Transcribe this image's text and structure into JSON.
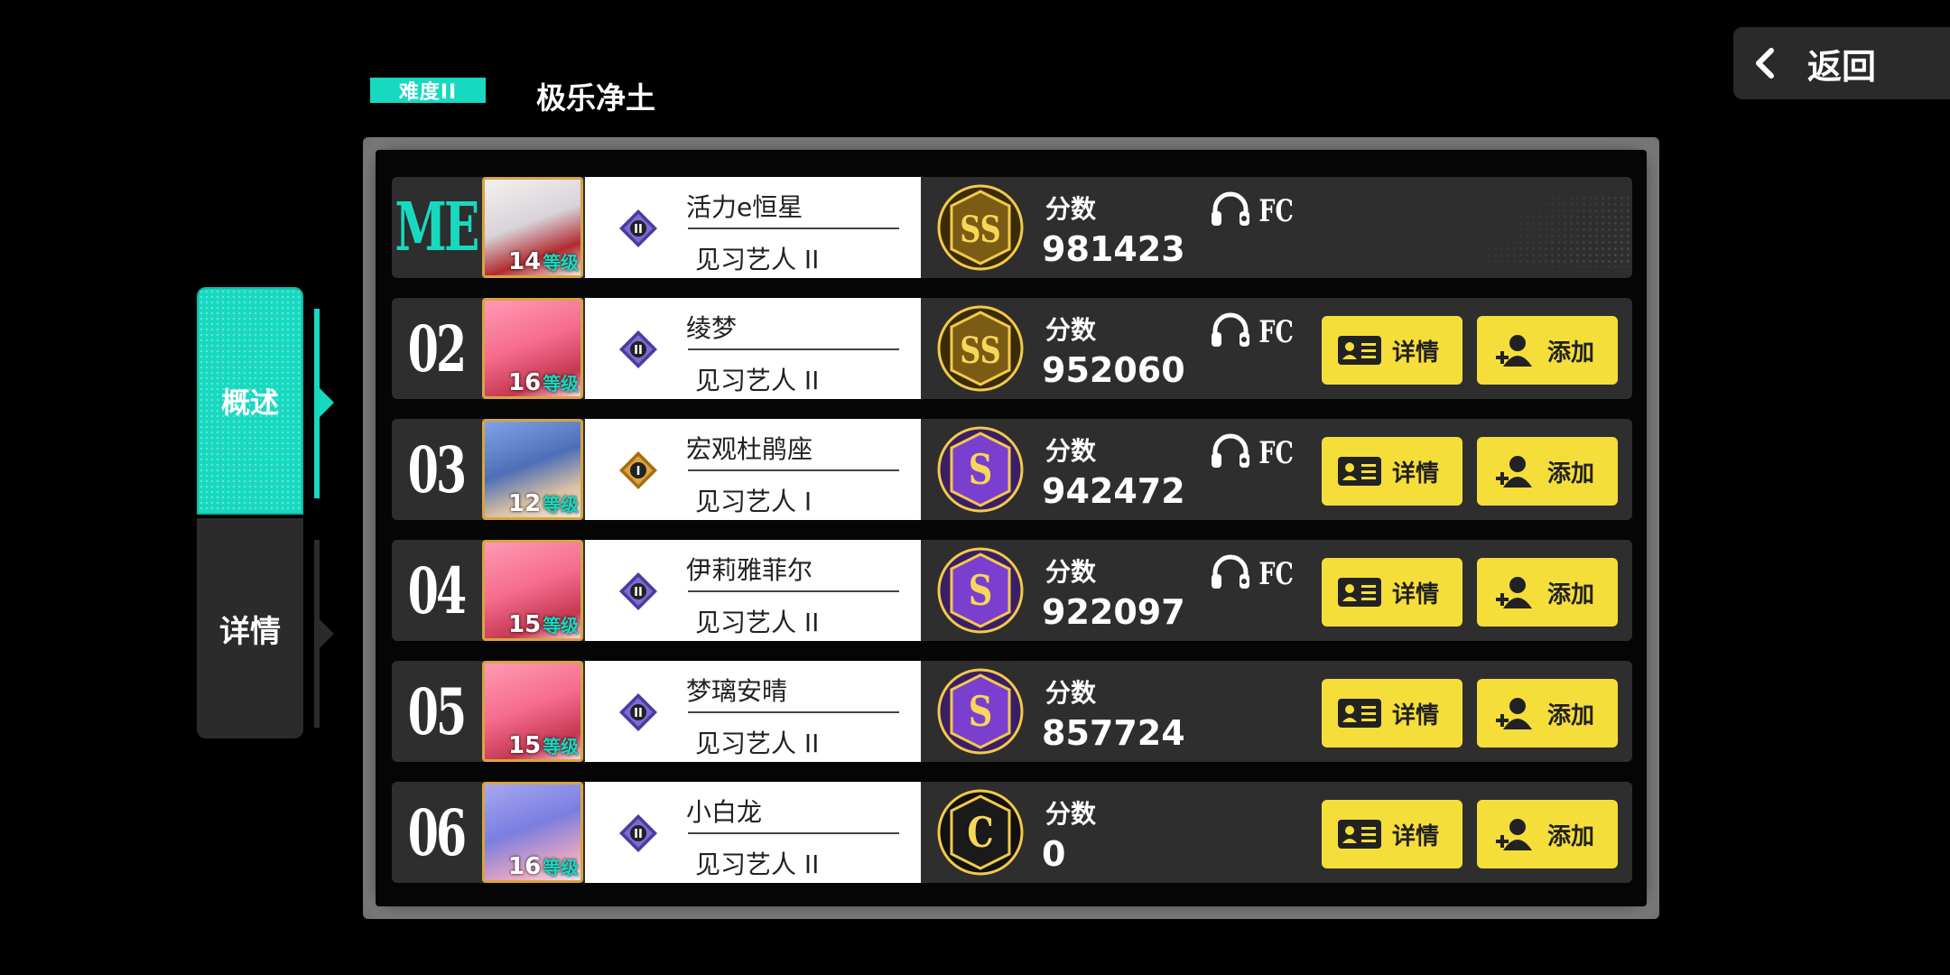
{
  "header": {
    "difficulty_badge": "难度II",
    "song_title": "极乐净土",
    "back_label": "返回"
  },
  "tabs": [
    {
      "label": "概述",
      "active": true
    },
    {
      "label": "详情",
      "active": false
    }
  ],
  "leaderboard": [
    {
      "rank": "ME",
      "level": "14",
      "level_suffix": "等级",
      "name": "活力e恒星",
      "title": "见习艺人 II",
      "medal": "II",
      "grade": "SS",
      "score_label": "分数",
      "score": "981423",
      "fc": true,
      "fc_label": "FC",
      "buttons": false
    },
    {
      "rank": "02",
      "level": "16",
      "level_suffix": "等级",
      "name": "绫梦",
      "title": "见习艺人 II",
      "medal": "II",
      "grade": "SS",
      "score_label": "分数",
      "score": "952060",
      "fc": true,
      "fc_label": "FC",
      "buttons": true,
      "detail_label": "详情",
      "add_label": "添加"
    },
    {
      "rank": "03",
      "level": "12",
      "level_suffix": "等级",
      "name": "宏观杜鹃座",
      "title": "见习艺人 I",
      "medal": "I",
      "grade": "S",
      "score_label": "分数",
      "score": "942472",
      "fc": true,
      "fc_label": "FC",
      "buttons": true,
      "detail_label": "详情",
      "add_label": "添加"
    },
    {
      "rank": "04",
      "level": "15",
      "level_suffix": "等级",
      "name": "伊莉雅菲尔",
      "title": "见习艺人 II",
      "medal": "II",
      "grade": "S",
      "score_label": "分数",
      "score": "922097",
      "fc": true,
      "fc_label": "FC",
      "buttons": true,
      "detail_label": "详情",
      "add_label": "添加"
    },
    {
      "rank": "05",
      "level": "15",
      "level_suffix": "等级",
      "name": "梦璃安晴",
      "title": "见习艺人 II",
      "medal": "II",
      "grade": "S",
      "score_label": "分数",
      "score": "857724",
      "fc": false,
      "buttons": true,
      "detail_label": "详情",
      "add_label": "添加"
    },
    {
      "rank": "06",
      "level": "16",
      "level_suffix": "等级",
      "name": "小白龙",
      "title": "见习艺人 II",
      "medal": "II",
      "grade": "C",
      "score_label": "分数",
      "score": "0",
      "fc": false,
      "buttons": true,
      "detail_label": "详情",
      "add_label": "添加"
    }
  ],
  "colors": {
    "accent": "#17d9c0",
    "button": "#f6de3a",
    "row_bg": "#2e2e2e",
    "gold_grade": "#f3c94a",
    "purple_grade": "#8a4fd8"
  }
}
